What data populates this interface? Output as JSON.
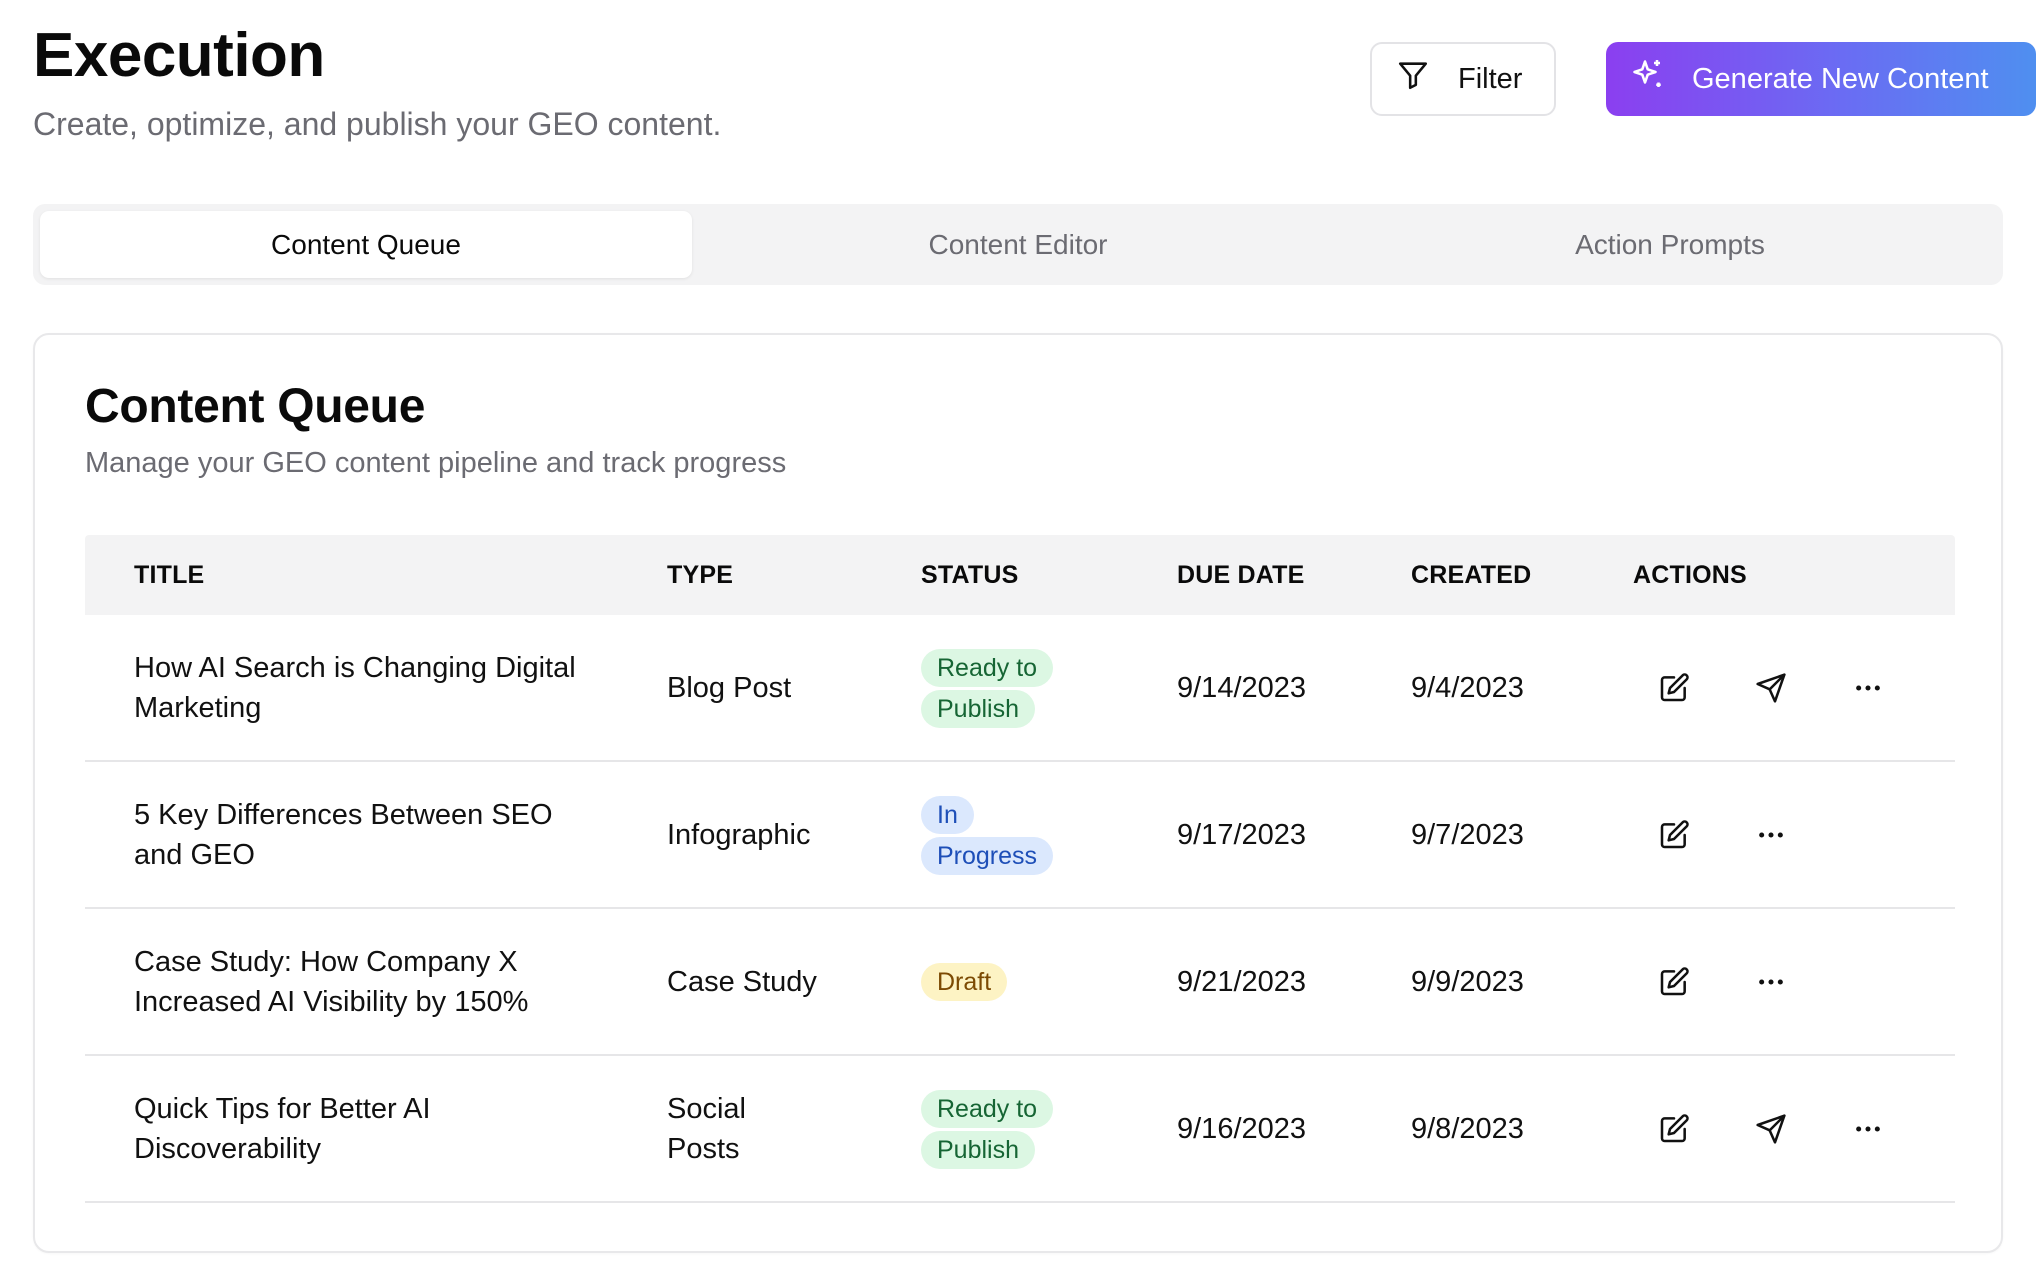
{
  "header": {
    "title": "Execution",
    "subtitle": "Create, optimize, and publish your GEO content.",
    "filter_label": "Filter",
    "generate_label": "Generate New Content"
  },
  "tabs": [
    {
      "label": "Content Queue",
      "active": true
    },
    {
      "label": "Content Editor",
      "active": false
    },
    {
      "label": "Action Prompts",
      "active": false
    }
  ],
  "card": {
    "title": "Content Queue",
    "subtitle": "Manage your GEO content pipeline and track progress"
  },
  "table": {
    "columns": [
      "TITLE",
      "TYPE",
      "STATUS",
      "DUE DATE",
      "CREATED",
      "ACTIONS"
    ],
    "rows": [
      {
        "title": "How AI Search is Changing Digital Marketing",
        "type": "Blog Post",
        "status": "Ready to Publish",
        "status_kind": "ready",
        "due": "9/14/2023",
        "created": "9/4/2023",
        "actions": [
          "edit-icon",
          "send-icon",
          "more-icon"
        ]
      },
      {
        "title": "5 Key Differences Between SEO and GEO",
        "type": "Infographic",
        "status": "In Progress",
        "status_kind": "progress",
        "due": "9/17/2023",
        "created": "9/7/2023",
        "actions": [
          "edit-icon",
          "more-icon"
        ]
      },
      {
        "title": "Case Study: How Company X Increased AI Visibility by 150%",
        "type": "Case Study",
        "status": "Draft",
        "status_kind": "draft",
        "due": "9/21/2023",
        "created": "9/9/2023",
        "actions": [
          "edit-icon",
          "more-icon"
        ]
      },
      {
        "title": "Quick Tips for Better AI Discoverability",
        "type": "Social Posts",
        "status": "Ready to Publish",
        "status_kind": "ready",
        "due": "9/16/2023",
        "created": "9/8/2023",
        "actions": [
          "edit-icon",
          "send-icon",
          "more-icon"
        ]
      }
    ]
  },
  "colors": {
    "accent_gradient_start": "#8b3ff0",
    "accent_gradient_end": "#4f8ff0",
    "ready_bg": "#dcf7e3",
    "progress_bg": "#dbe8fd",
    "draft_bg": "#fdf3c4"
  }
}
